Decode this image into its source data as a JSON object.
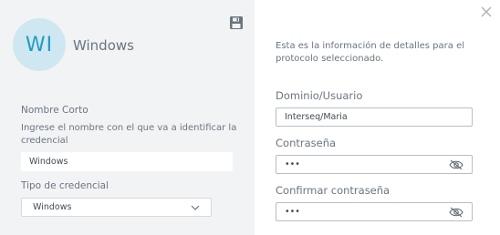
{
  "header": {
    "avatar_initials": "WI",
    "title": "Windows"
  },
  "left_form": {
    "short_name_label": "Nombre Corto",
    "short_name_help": "Ingrese el nombre con el que va a identificar la credencial",
    "short_name_value": "Windows",
    "credential_type_label": "Tipo de credencial",
    "credential_type_value": "Windows"
  },
  "right_form": {
    "info": "Esta es la información de detalles para el protocolo seleccionado.",
    "user_label": "Dominio/Usuario",
    "user_value": "Interseq/Maria",
    "password_label": "Contraseña",
    "password_value": "•••",
    "confirm_label": "Confirmar contraseña",
    "confirm_value": "•••"
  },
  "icons": {
    "save": "save-icon",
    "close": "close-icon",
    "chevron": "chevron-down-icon",
    "eye": "eye-slash-icon"
  },
  "colors": {
    "avatar_bg": "#cfe7f0",
    "avatar_text": "#1d9cc4",
    "panel_bg": "#f2f3f5"
  }
}
